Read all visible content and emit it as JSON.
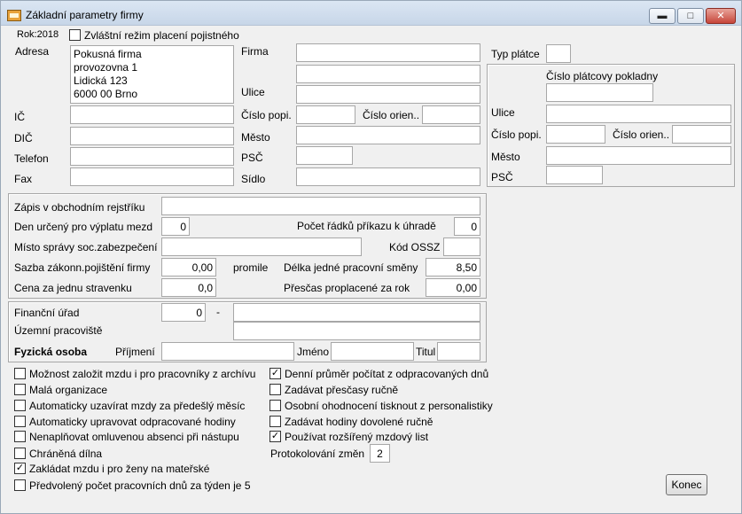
{
  "window": {
    "title": "Základní parametry firmy",
    "controls": {
      "minimize": "▬",
      "maximize": "□",
      "close": "✕"
    }
  },
  "header": {
    "year": "Rok:2018",
    "special_regime_label": "Zvláštní režim placení pojistného",
    "special_regime_checked": false
  },
  "address": {
    "label": "Adresa",
    "text": "Pokusná firma\nprovozovna 1\nLidická 123\n6000 00 Brno"
  },
  "contacts": [
    {
      "label": "IČ",
      "value": ""
    },
    {
      "label": "DIČ",
      "value": ""
    },
    {
      "label": "Telefon",
      "value": ""
    },
    {
      "label": "Fax",
      "value": ""
    }
  ],
  "company": {
    "firma_label": "Firma",
    "firma_1": "",
    "firma_2": "",
    "ulice_label": "Ulice",
    "ulice": "",
    "cislo_popi_label": "Číslo popi.",
    "cislo_popi": "",
    "cislo_orien_label": "Číslo orien..",
    "cislo_orien": "",
    "mesto_label": "Město",
    "mesto": "",
    "psc_label": "PSČ",
    "psc": "",
    "sidlo_label": "Sídlo",
    "sidlo": ""
  },
  "payer": {
    "typ_platce_label": "Typ plátce",
    "typ_platce": "",
    "cislo_platcovy_label": "Číslo plátcovy pokladny",
    "cislo_platcovy": "",
    "ulice_label": "Ulice",
    "ulice": "",
    "cislo_popi_label": "Číslo popi.",
    "cislo_popi": "",
    "cislo_orien_label": "Číslo orien..",
    "cislo_orien": "",
    "mesto_label": "Město",
    "mesto": "",
    "psc_label": "PSČ",
    "psc": ""
  },
  "registry": {
    "zapis_label": "Zápis v obchodním rejstříku",
    "zapis": "",
    "den_label": "Den určený pro výplatu mezd",
    "den": "0",
    "pocet_label": "Počet řádků příkazu k úhradě",
    "pocet": "0",
    "misto_label": "Místo správy  soc.zabezpečení",
    "misto": "",
    "kod_label": "Kód OSSZ",
    "kod": "",
    "sazba_label": "Sazba zákonn.pojištění firmy",
    "sazba": "0,00",
    "promile": "promile",
    "delka_label": "Délka jedné pracovní směny",
    "delka": "8,50",
    "cena_label": "Cena za jednu stravenku",
    "cena": "0,0",
    "prescas_label": "Přesčas proplacené za rok",
    "prescas": "0,00"
  },
  "tax": {
    "financni_label": "Finanční úřad",
    "financni_code": "0",
    "dash": "-",
    "financni_name": "",
    "uzemni_label": "Územní pracoviště",
    "uzemni": "",
    "fyzicka_label": "Fyzická osoba",
    "prijmeni_label": "Příjmení",
    "prijmeni": "",
    "jmeno_label": "Jméno",
    "jmeno": "",
    "titul_label": "Titul",
    "titul": ""
  },
  "options_left": [
    {
      "label": "Možnost založit mzdu i pro pracovníky z archívu",
      "checked": false
    },
    {
      "label": "Malá organizace",
      "checked": false
    },
    {
      "label": "Automaticky uzavírat mzdy za předešlý měsíc",
      "checked": false
    },
    {
      "label": "Automaticky upravovat odpracované hodiny",
      "checked": false
    },
    {
      "label": "Nenaplňovat omluvenou absenci při nástupu",
      "checked": false
    },
    {
      "label": "Chráněná dílna",
      "checked": false
    },
    {
      "label": "Zakládat mzdu i pro ženy na mateřské",
      "checked": true
    },
    {
      "label": "Předvolený počet pracovních dnů za týden je 5",
      "checked": false
    }
  ],
  "options_right": [
    {
      "label": "Denní průměr počítat z odpracovaných dnů",
      "checked": true
    },
    {
      "label": "Zadávat přesčasy ručně",
      "checked": false
    },
    {
      "label": "Osobní ohodnocení tisknout z personalistiky",
      "checked": false
    },
    {
      "label": "Zadávat hodiny dovolené ručně",
      "checked": false
    },
    {
      "label": "Používat rozšířený mzdový list",
      "checked": true
    }
  ],
  "protokol": {
    "label": "Protokolování změn",
    "value": "2"
  },
  "buttons": {
    "konec": "Konec"
  }
}
